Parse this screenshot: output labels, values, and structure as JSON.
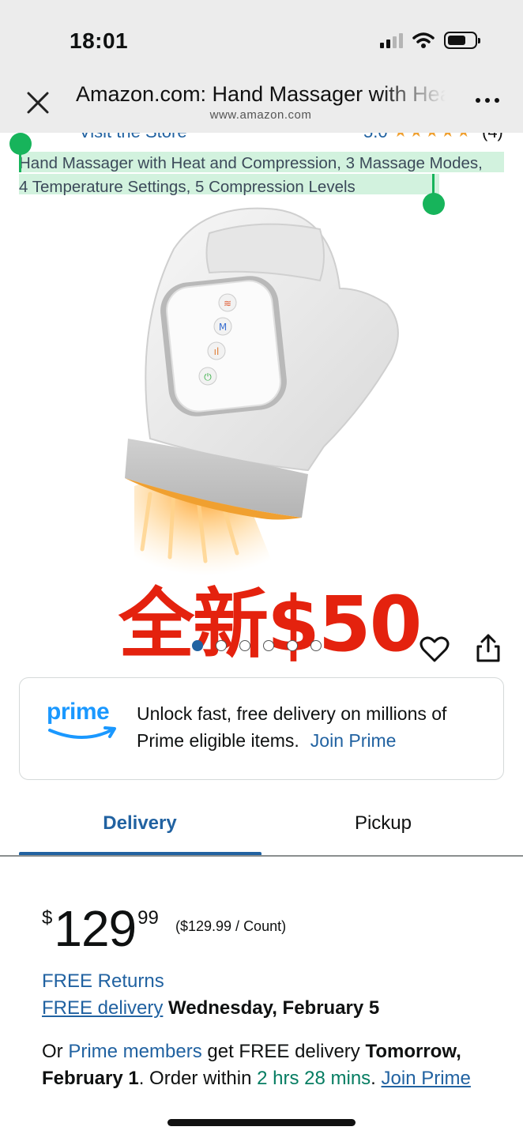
{
  "status_bar": {
    "time": "18:01"
  },
  "browser": {
    "page_title": "Amazon.com: Hand Massager with Heat",
    "url": "www.amazon.com"
  },
  "store_row": {
    "link": "Visit the Store",
    "rating": "5.0",
    "count": "(4)"
  },
  "product": {
    "title": "Hand Massager with Heat and Compression, 3 Massage Modes, 4 Temperature Settings, 5 Compression Levels",
    "overlay_text": "全新$50",
    "image_dot_count": 6,
    "active_image_index": 0
  },
  "prime_box": {
    "logo_text": "prime",
    "message": "Unlock fast, free delivery on millions of Prime eligible items.",
    "link": "Join Prime"
  },
  "tabs": [
    {
      "label": "Delivery",
      "selected": true
    },
    {
      "label": "Pickup",
      "selected": false
    }
  ],
  "price": {
    "symbol": "$",
    "whole": "129",
    "fraction": "99",
    "unit_price": "($129.99 / Count)"
  },
  "returns": "FREE Returns",
  "delivery": {
    "link": "FREE delivery",
    "date": "Wednesday, February 5"
  },
  "prime_delivery": {
    "prefix": "Or",
    "link": "Prime members",
    "middle": "get FREE delivery",
    "date_bold": "Tomorrow, February 1",
    "order_within": ". Order within",
    "countdown": "2 hrs 28 mins",
    "period": ".",
    "join_link": "Join Prime"
  },
  "colors": {
    "link_blue": "#2162a1",
    "prime_blue": "#1a98ff",
    "selection_green": "#17b45b",
    "overlay_red": "#e4220e",
    "countdown_green": "#067d62"
  }
}
